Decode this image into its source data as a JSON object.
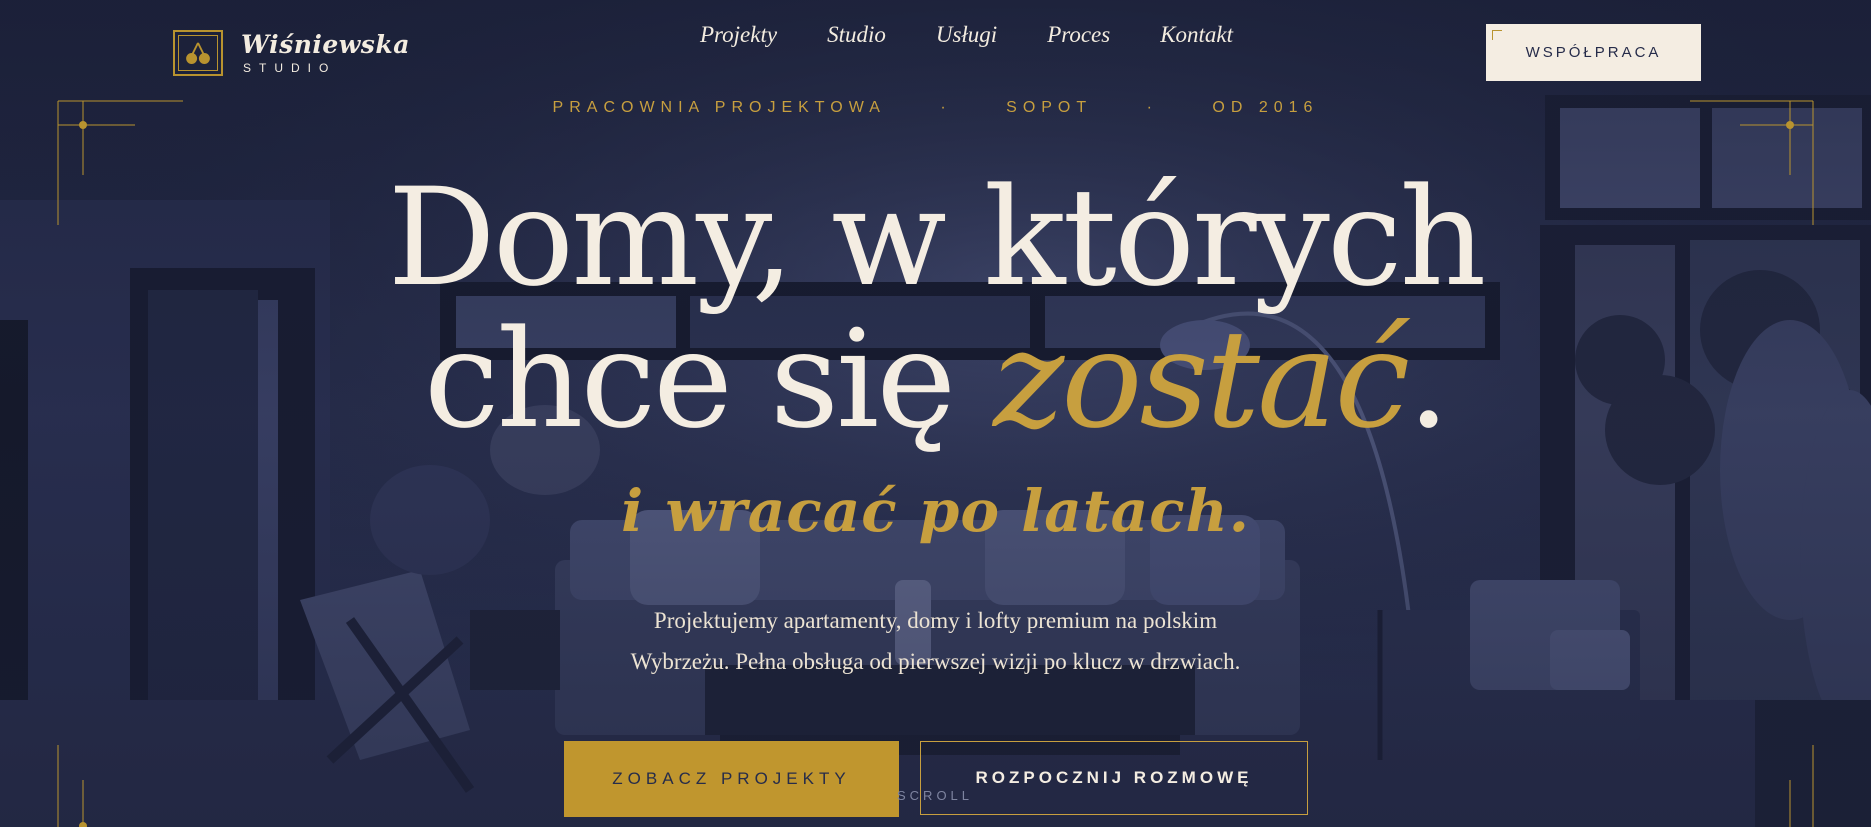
{
  "brand": {
    "name": "Wiśniewska",
    "sub": "STUDIO",
    "icon": "cherry-icon"
  },
  "nav": {
    "items": [
      {
        "label": "Projekty"
      },
      {
        "label": "Studio"
      },
      {
        "label": "Usługi"
      },
      {
        "label": "Proces"
      },
      {
        "label": "Kontakt"
      }
    ]
  },
  "header_cta": {
    "label": "WSPÓŁPRACA"
  },
  "hero": {
    "eyebrow": {
      "part1": "PRACOWNIA PROJEKTOWA",
      "sep": "·",
      "part2": "SOPOT",
      "part3": "OD 2016"
    },
    "headline_line1": "Domy, w których",
    "headline_line2_start": "chce się ",
    "headline_accent": "zostać",
    "headline_end": ".",
    "script": "i wracać po latach.",
    "description_line1": "Projektujemy apartamenty, domy i lofty premium na polskim",
    "description_line2": "Wybrzeżu. Pełna obsługa od pierwszej wizji po klucz w drzwiach.",
    "primary_cta": "ZOBACZ PROJEKTY",
    "secondary_cta": "ROZPOCZNIJ ROZMOWĘ",
    "scroll_hint": "SCROLL"
  },
  "colors": {
    "navy": "#262c4a",
    "gold": "#c79f3f",
    "cream": "#f4ede2"
  }
}
